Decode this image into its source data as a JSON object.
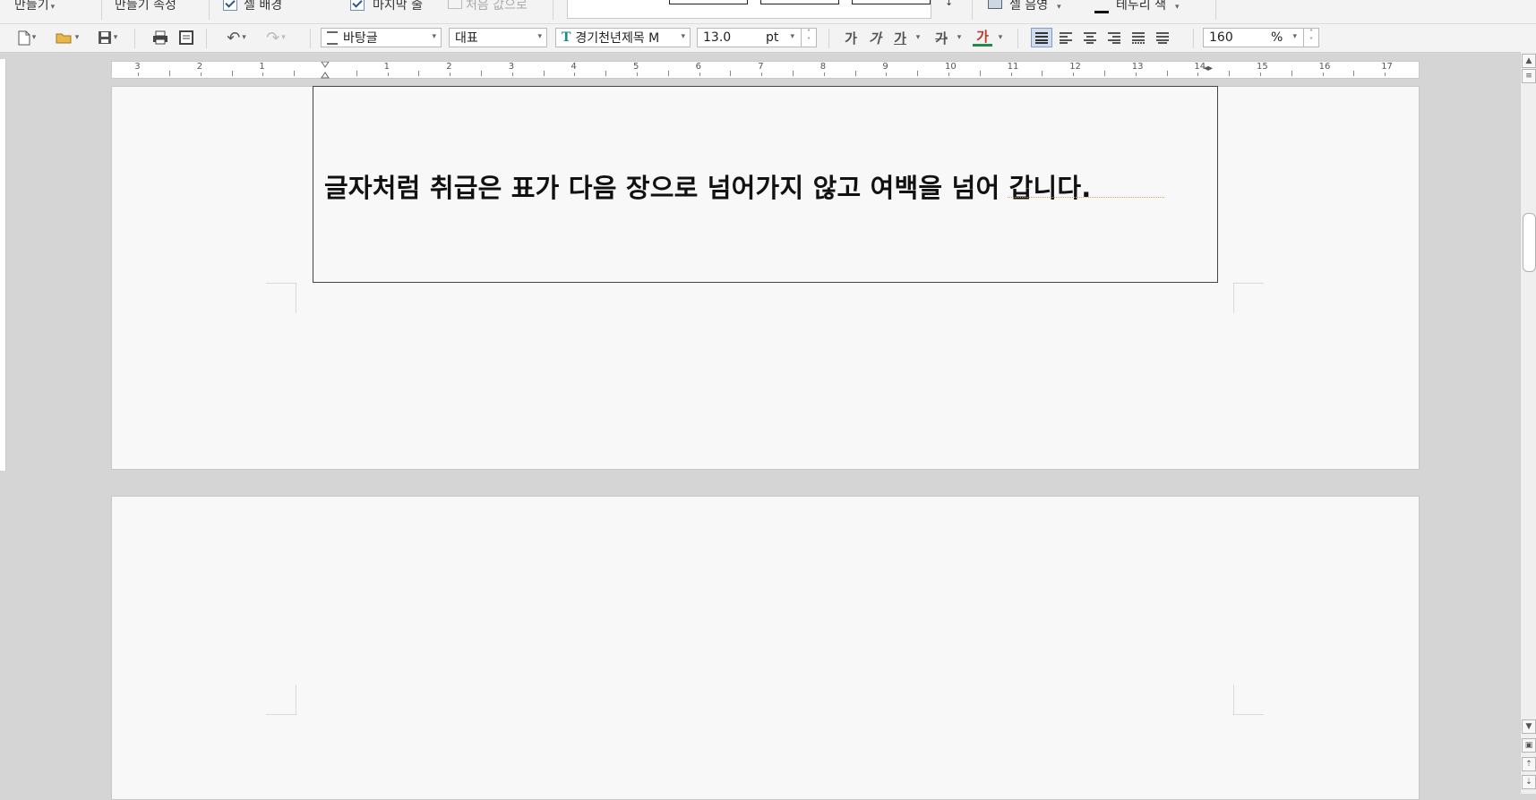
{
  "ribbon": {
    "make_menu": "만들기",
    "make_props": "만들기 속성",
    "cell_layout": "셀 배경",
    "last_line": "마지막 줄",
    "default_value": "처음 값으로",
    "cell_shading": "셀 음영",
    "border_color": "테두리 색"
  },
  "toolbar": {
    "style": "바탕글",
    "language": "대표",
    "font": "경기천년제목 M",
    "font_size": "13.0",
    "size_unit": "pt",
    "format_bold": "가",
    "format_italic": "가",
    "format_underline": "가",
    "format_strike": "가",
    "format_color": "가",
    "zoom": "160",
    "zoom_unit": "%"
  },
  "ruler": {
    "labels": [
      "3",
      "2",
      "1",
      "1",
      "2",
      "3",
      "4",
      "5",
      "6",
      "7",
      "8",
      "9",
      "10",
      "11",
      "12",
      "13",
      "14",
      "15",
      "16",
      "17"
    ]
  },
  "document": {
    "table_text": "글자처럼 취급은 표가 다음 장으로 넘어가지 않고 여백을 넘어 갑니다."
  },
  "colors": {
    "accent": "#2b5797",
    "text_color_underline": "#d9352b",
    "paper": "#f8f8f8",
    "workspace": "#d5d5d5"
  }
}
